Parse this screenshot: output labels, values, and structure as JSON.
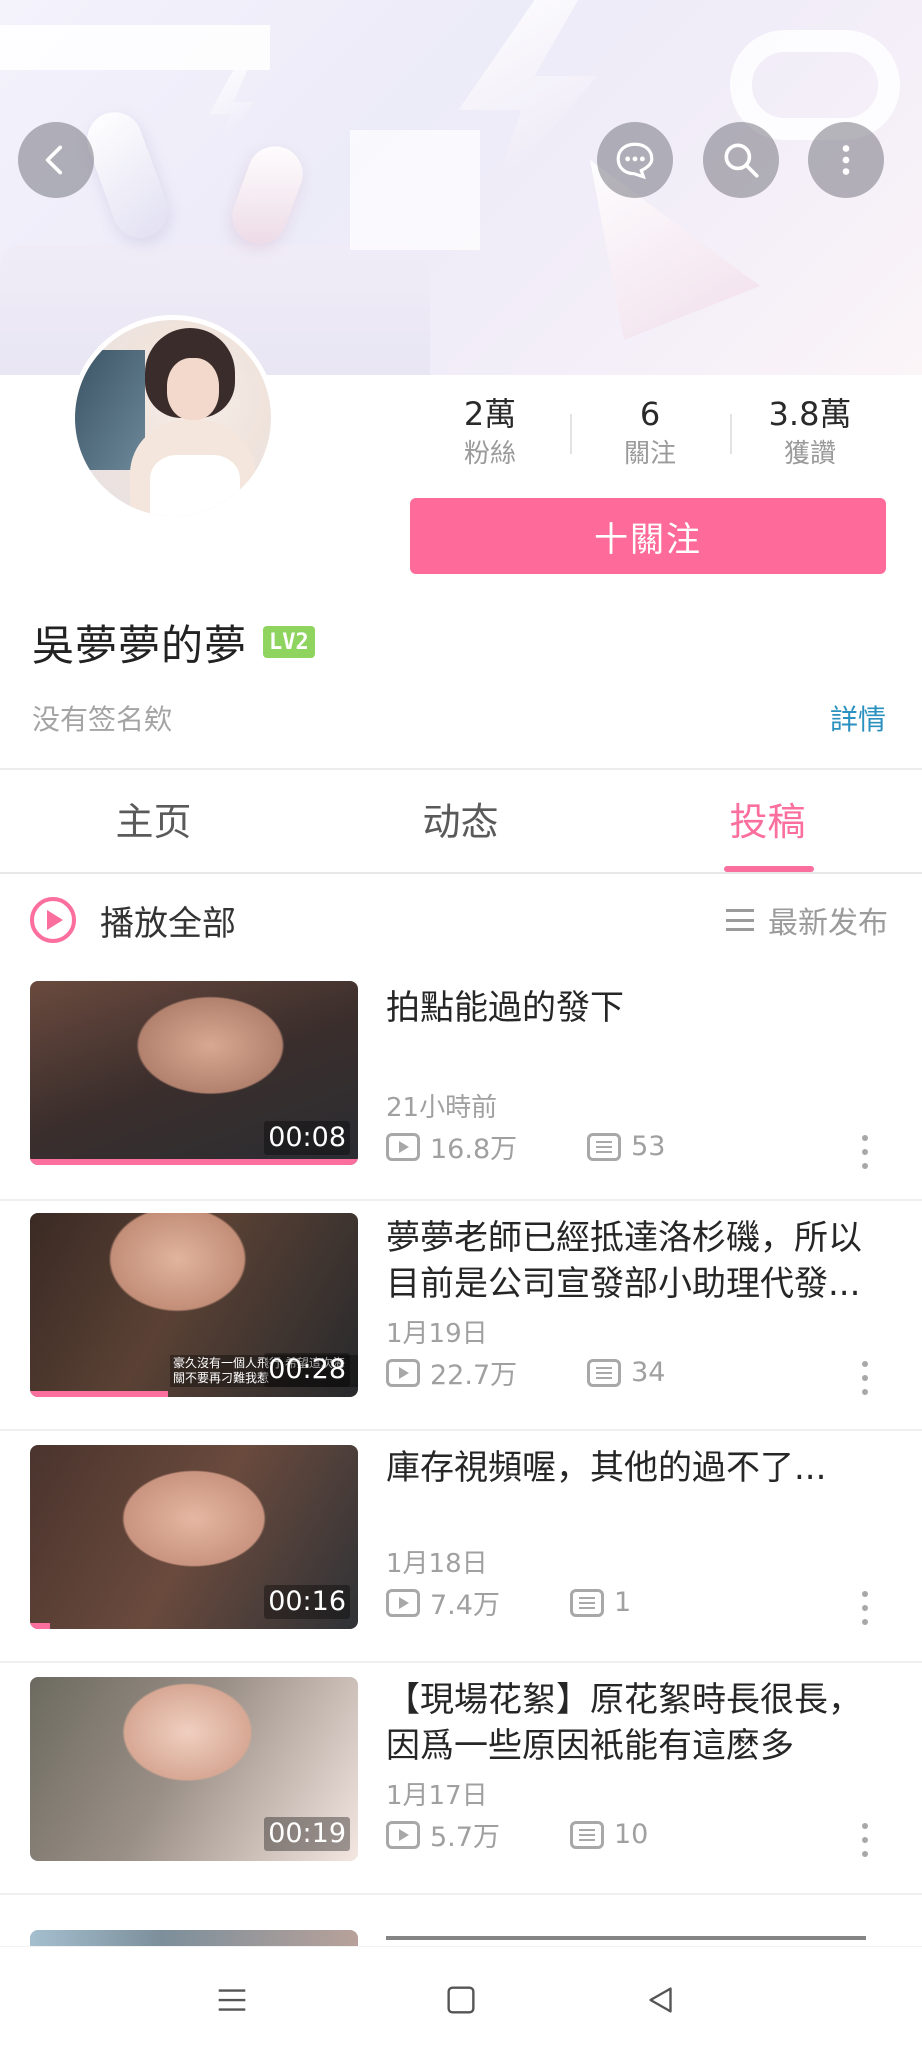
{
  "header": {
    "back_icon": "back-arrow-icon",
    "chat_icon": "chat-bubble-icon",
    "search_icon": "search-icon",
    "more_icon": "more-vertical-icon"
  },
  "profile": {
    "name": "吳夢夢的夢",
    "level_badge": "LV2",
    "signature": "没有签名欸",
    "details_link": "詳情",
    "stats": [
      {
        "value": "2萬",
        "label": "粉絲"
      },
      {
        "value": "6",
        "label": "關注"
      },
      {
        "value": "3.8萬",
        "label": "獲讚"
      }
    ],
    "follow_button": "十關注"
  },
  "tabs": [
    {
      "label": "主页",
      "active": false
    },
    {
      "label": "动态",
      "active": false
    },
    {
      "label": "投稿",
      "active": true
    }
  ],
  "list_controls": {
    "play_all": "播放全部",
    "sort": "最新发布"
  },
  "videos": [
    {
      "title": "拍點能過的發下",
      "date": "21小時前",
      "views": "16.8万",
      "comments": "53",
      "duration": "00:08",
      "progress": 1.0,
      "caption": ""
    },
    {
      "title": "夢夢老師已經抵達洛杉磯，所以目前是公司宣發部小助理代發...",
      "date": "1月19日",
      "views": "22.7万",
      "comments": "34",
      "duration": "00:28",
      "progress": 0.42,
      "caption": "豪久沒有一個人飛行 希望這次海關不要再刁難我惹"
    },
    {
      "title": "庫存視頻喔，其他的過不了...",
      "date": "1月18日",
      "views": "7.4万",
      "comments": "1",
      "duration": "00:16",
      "progress": 0.06,
      "caption": ""
    },
    {
      "title": "【現場花絮】原花絮時長很長，因爲一些原因衹能有這麽多",
      "date": "1月17日",
      "views": "5.7万",
      "comments": "10",
      "duration": "00:19",
      "progress": 0.0,
      "caption": ""
    }
  ],
  "colors": {
    "accent_pink": "#fe6b9a",
    "link_blue": "#2a91c0",
    "level_green": "#8fd45f"
  },
  "navbar": {
    "menu_icon": "menu-icon",
    "home_icon": "home-square-icon",
    "back_icon": "back-triangle-icon"
  }
}
